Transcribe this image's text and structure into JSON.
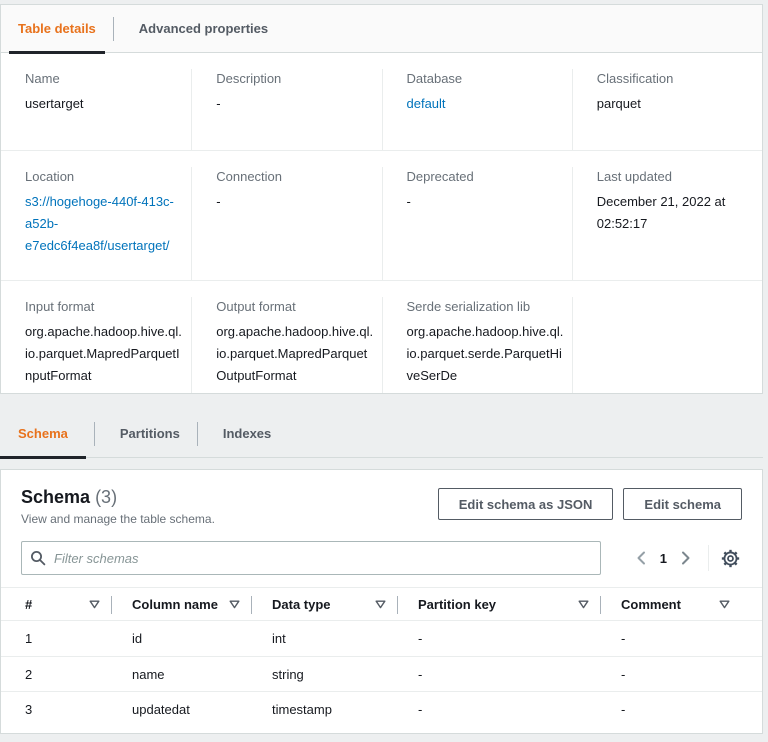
{
  "colors": {
    "accent_orange": "#e8721c",
    "link_blue": "#0073bb",
    "text_dark": "#16191f",
    "text_gray": "#687078",
    "panel_border": "#d5dbdb",
    "active_tab_underline": "#20242a",
    "page_background": "#edeff0"
  },
  "details_tabs": {
    "items": [
      {
        "label": "Table details",
        "active": true
      },
      {
        "label": "Advanced properties",
        "active": false
      }
    ]
  },
  "details": {
    "rows": [
      [
        {
          "label": "Name",
          "value": "usertarget"
        },
        {
          "label": "Description",
          "value": "-"
        },
        {
          "label": "Database",
          "value": "default"
        },
        {
          "label": "Classification",
          "value": "parquet"
        }
      ],
      [
        {
          "label": "Location",
          "value": "s3://hogehoge-440f-413c-a52b-e7edc6f4ea8f/usertarget/"
        },
        {
          "label": "Connection",
          "value": "-"
        },
        {
          "label": "Deprecated",
          "value": "-"
        },
        {
          "label": "Last updated",
          "value": "December 21, 2022 at 02:52:17"
        }
      ],
      [
        {
          "label": "Input format",
          "value": "org.apache.hadoop.hive.ql.io.parquet.MapredParquetInputFormat"
        },
        {
          "label": "Output format",
          "value": "org.apache.hadoop.hive.ql.io.parquet.MapredParquetOutputFormat"
        },
        {
          "label": "Serde serialization lib",
          "value": "org.apache.hadoop.hive.ql.io.parquet.serde.ParquetHiveSerDe"
        },
        {
          "label": "",
          "value": ""
        }
      ]
    ]
  },
  "schema_tabs": {
    "items": [
      {
        "label": "Schema",
        "active": true
      },
      {
        "label": "Partitions",
        "active": false
      },
      {
        "label": "Indexes",
        "active": false
      }
    ]
  },
  "schema_panel": {
    "title": "Schema",
    "count": "(3)",
    "subtitle": "View and manage the table schema.",
    "buttons": {
      "edit_json": "Edit schema as JSON",
      "edit": "Edit schema"
    },
    "filter_placeholder": "Filter schemas",
    "pagination": {
      "page": "1"
    },
    "icons": {
      "search": "search-icon",
      "gear": "settings-gear-icon",
      "column_filter": "column-filter-icon",
      "prev": "chevron-left-icon",
      "next": "chevron-right-icon"
    },
    "table": {
      "columns": [
        "#",
        "Column name",
        "Data type",
        "Partition key",
        "Comment"
      ],
      "rows": [
        [
          "1",
          "id",
          "int",
          "-",
          "-"
        ],
        [
          "2",
          "name",
          "string",
          "-",
          "-"
        ],
        [
          "3",
          "updatedat",
          "timestamp",
          "-",
          "-"
        ]
      ]
    }
  }
}
